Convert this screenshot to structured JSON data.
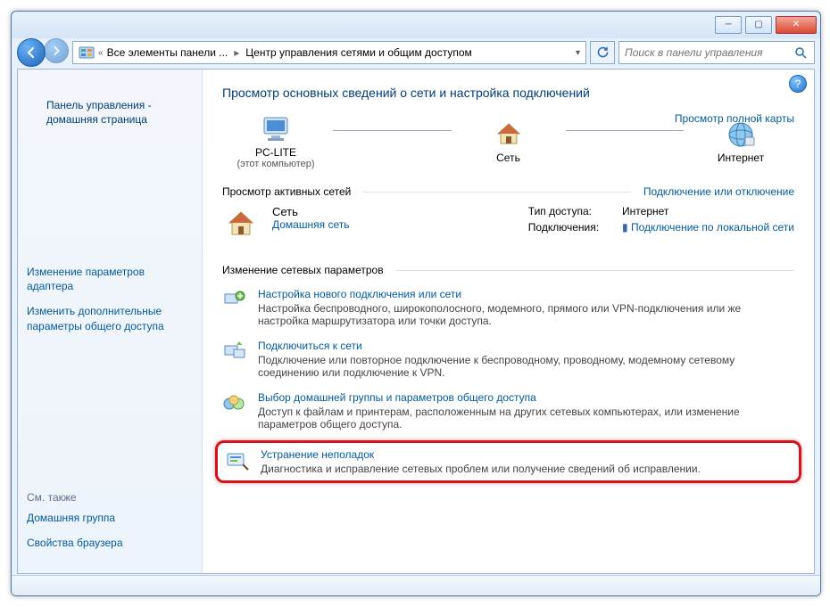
{
  "breadcrumb": {
    "root_icon": "control-panel-icon",
    "lvl1": "Все элементы панели ...",
    "lvl2": "Центр управления сетями и общим доступом"
  },
  "search": {
    "placeholder": "Поиск в панели управления"
  },
  "sidebar": {
    "home": "Панель управления - домашняя страница",
    "links": [
      "Изменение параметров адаптера",
      "Изменить дополнительные параметры общего доступа"
    ],
    "seealso_heading": "См. также",
    "seealso": [
      "Домашняя группа",
      "Свойства браузера"
    ]
  },
  "heading": "Просмотр основных сведений о сети и настройка подключений",
  "map": {
    "node1_label": "PC-LITE",
    "node1_sub": "(этот компьютер)",
    "node2_label": "Сеть",
    "node3_label": "Интернет",
    "full_map": "Просмотр полной карты"
  },
  "active": {
    "heading": "Просмотр активных сетей",
    "right": "Подключение или отключение",
    "net_name": "Сеть",
    "net_type": "Домашняя сеть",
    "kv": {
      "k1": "Тип доступа:",
      "v1": "Интернет",
      "k2": "Подключения:",
      "v2": "Подключение по локальной сети"
    }
  },
  "change": {
    "heading": "Изменение сетевых параметров",
    "items": [
      {
        "title": "Настройка нового подключения или сети",
        "desc": "Настройка беспроводного, широкополосного, модемного, прямого или VPN-подключения или же настройка маршрутизатора или точки доступа."
      },
      {
        "title": "Подключиться к сети",
        "desc": "Подключение или повторное подключение к беспроводному, проводному, модемному сетевому соединению или подключение к VPN."
      },
      {
        "title": "Выбор домашней группы и параметров общего доступа",
        "desc": "Доступ к файлам и принтерам, расположенным на других сетевых компьютерах, или изменение параметров общего доступа."
      },
      {
        "title": "Устранение неполадок",
        "desc": "Диагностика и исправление сетевых проблем или получение сведений об исправлении."
      }
    ]
  }
}
